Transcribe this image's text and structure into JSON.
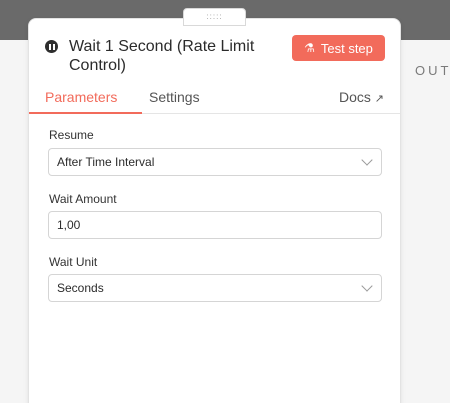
{
  "canvas": {
    "output_label": "OUT"
  },
  "drag_handle": {
    "glyph": ":::::"
  },
  "node": {
    "title": "Wait 1 Second (Rate Limit Control)",
    "test_label": "Test step",
    "test_icon": "flask-icon"
  },
  "tabs": [
    {
      "label": "Parameters",
      "active": true
    },
    {
      "label": "Settings",
      "active": false
    }
  ],
  "docs": {
    "label": "Docs",
    "icon": "external-link-icon"
  },
  "fields": {
    "resume": {
      "label": "Resume",
      "value": "After Time Interval"
    },
    "wait_amount": {
      "label": "Wait Amount",
      "value": "1,00"
    },
    "wait_unit": {
      "label": "Wait Unit",
      "value": "Seconds"
    }
  },
  "colors": {
    "accent": "#f26b5b",
    "topbar": "#6a6a6a"
  }
}
